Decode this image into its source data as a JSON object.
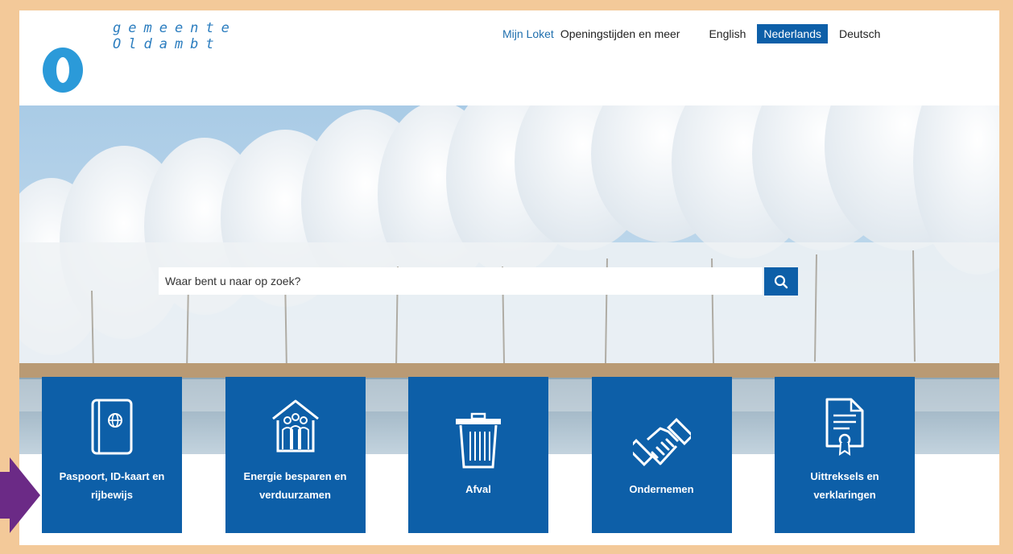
{
  "logo": {
    "line1": "gemeente",
    "line2": "Oldambt"
  },
  "topnav": {
    "mijn_loket": "Mijn Loket",
    "openingstijden": "Openingstijden en meer",
    "languages": [
      {
        "label": "English",
        "active": false
      },
      {
        "label": "Nederlands",
        "active": true
      },
      {
        "label": "Deutsch",
        "active": false
      }
    ]
  },
  "search": {
    "placeholder": "Waar bent u naar op zoek?",
    "icon": "search-icon"
  },
  "tiles": [
    {
      "label": "Paspoort, ID-kaart en rijbewijs",
      "icon": "passport-icon"
    },
    {
      "label": "Energie besparen en verduurzamen",
      "icon": "house-people-icon"
    },
    {
      "label": "Afval",
      "icon": "trash-bin-icon"
    },
    {
      "label": "Ondernemen",
      "icon": "handshake-icon"
    },
    {
      "label": "Uittreksels en verklaringen",
      "icon": "certificate-icon"
    }
  ],
  "colors": {
    "brand_blue": "#0d5fa8",
    "logo_blue": "#2b9ad9",
    "frame_border": "#f3c999",
    "annotation_arrow": "#6b2a86"
  }
}
